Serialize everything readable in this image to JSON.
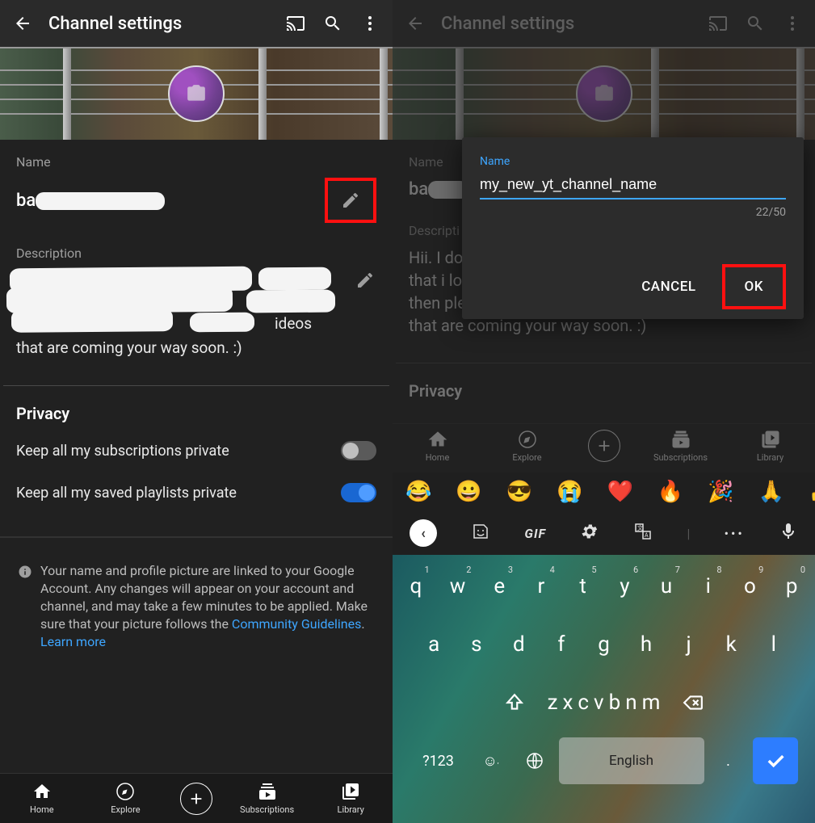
{
  "left": {
    "header_title": "Channel settings",
    "name_label": "Name",
    "name_value_prefix": "ba",
    "desc_label": "Description",
    "desc_line3_fragment": "ideos",
    "desc_line4": "that are coming your way soon. :)",
    "privacy_title": "Privacy",
    "privacy_subs": "Keep all my subscriptions private",
    "privacy_playlists": "Keep all my saved playlists private",
    "info_text": "Your name and profile picture are linked to your Google Account. Any changes will appear on your account and channel, and may take a few minutes to be applied. Make sure that your picture follows the ",
    "guidelines_link": "Community Guidelines",
    "learn_more": "Learn more",
    "nav": {
      "home": "Home",
      "explore": "Explore",
      "subs": "Subscriptions",
      "library": "Library"
    }
  },
  "right": {
    "header_title": "Channel settings",
    "name_label": "Name",
    "name_value_prefix": "ba",
    "desc_label": "Descripti",
    "desc_line1": "Hii. I do",
    "desc_line2": "that i lov",
    "desc_line3": "then ple",
    "desc_line4": "that are coming your way soon. :)",
    "privacy_title": "Privacy",
    "dialog": {
      "label": "Name",
      "value": "my_new_yt_channel_name",
      "counter": "22/50",
      "cancel": "CANCEL",
      "ok": "OK"
    },
    "nav": {
      "home": "Home",
      "explore": "Explore",
      "subs": "Subscriptions",
      "library": "Library"
    },
    "emoji": [
      "😂",
      "😀",
      "😎",
      "😭",
      "❤️",
      "🔥",
      "🎉",
      "🙏",
      "👍",
      "☺"
    ],
    "toolbar_gif": "GIF",
    "kb": {
      "row1": [
        "q",
        "w",
        "e",
        "r",
        "t",
        "y",
        "u",
        "i",
        "o",
        "p"
      ],
      "row1_sup": [
        "1",
        "2",
        "3",
        "4",
        "5",
        "6",
        "7",
        "8",
        "9",
        "0"
      ],
      "row2": [
        "a",
        "s",
        "d",
        "f",
        "g",
        "h",
        "j",
        "k",
        "l"
      ],
      "row3": [
        "z",
        "x",
        "c",
        "v",
        "b",
        "n",
        "m"
      ],
      "sym": "?123",
      "space": "English"
    }
  }
}
